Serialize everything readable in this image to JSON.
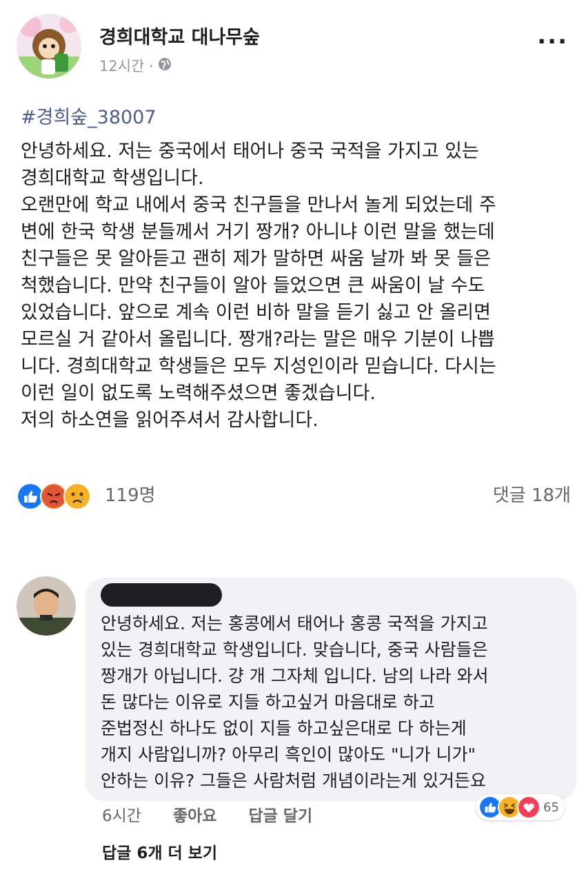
{
  "page": {
    "name": "경희대학교 대나무숲",
    "time": "12시간 ·",
    "audience_icon": "globe-icon",
    "more_label": "..."
  },
  "post": {
    "hashtag": "#경희숲_38007",
    "lines": [
      "안녕하세요. 저는 중국에서 태어나 중국 국적을 가지고 있는",
      "경희대학교 학생입니다.",
      "오랜만에 학교 내에서 중국 친구들을 만나서 놀게 되었는데 주",
      "변에 한국 학생 분들께서 거기 짱개? 아니냐 이런 말을 했는데",
      "친구들은 못 알아듣고 괜히 제가 말하면 싸움 날까 봐 못 들은",
      "척했습니다. 만약 친구들이 알아 들었으면 큰 싸움이 날 수도",
      "있었습니다. 앞으로 계속 이런 비하 말을 듣기 싫고 안 올리면",
      "모르실 거 같아서 올립니다. 짱개?라는 말은 매우 기분이 나쁩",
      "니다. 경희대학교 학생들은 모두 지성인이라 믿습니다. 다시는",
      "이런 일이 없도록 노력해주셨으면 좋겠습니다.",
      "저의 하소연을 읽어주셔서 감사합니다."
    ],
    "reaction_count": "119명",
    "comment_count": "댓글 18개",
    "reaction_colors": {
      "like": "#1877f2",
      "angry": "#e9710f",
      "sad": "#f7b125"
    }
  },
  "comment": {
    "lines": [
      "안녕하세요. 저는 홍콩에서 태어나 홍콩 국적을 가지고",
      "있는 경희대학교 학생입니다. 맞습니다, 중국 사람들은",
      "짱개가 아닙니다. 걍 개 그자체 입니다. 남의 나라 와서",
      "돈 많다는 이유로 지들 하고싶거 마음대로 하고",
      "준법정신 하나도 없이 지들 하고싶은대로 다 하는게",
      "개지 사람입니까? 아무리 흑인이 많아도 \"니가 니가\"",
      "안하는 이유? 그들은 사람처럼 개념이라는게 있거든요"
    ],
    "time": "6시간",
    "like_label": "좋아요",
    "reply_label": "답글 달기",
    "reaction_count": "65",
    "more_replies": "답글 6개 더 보기"
  }
}
